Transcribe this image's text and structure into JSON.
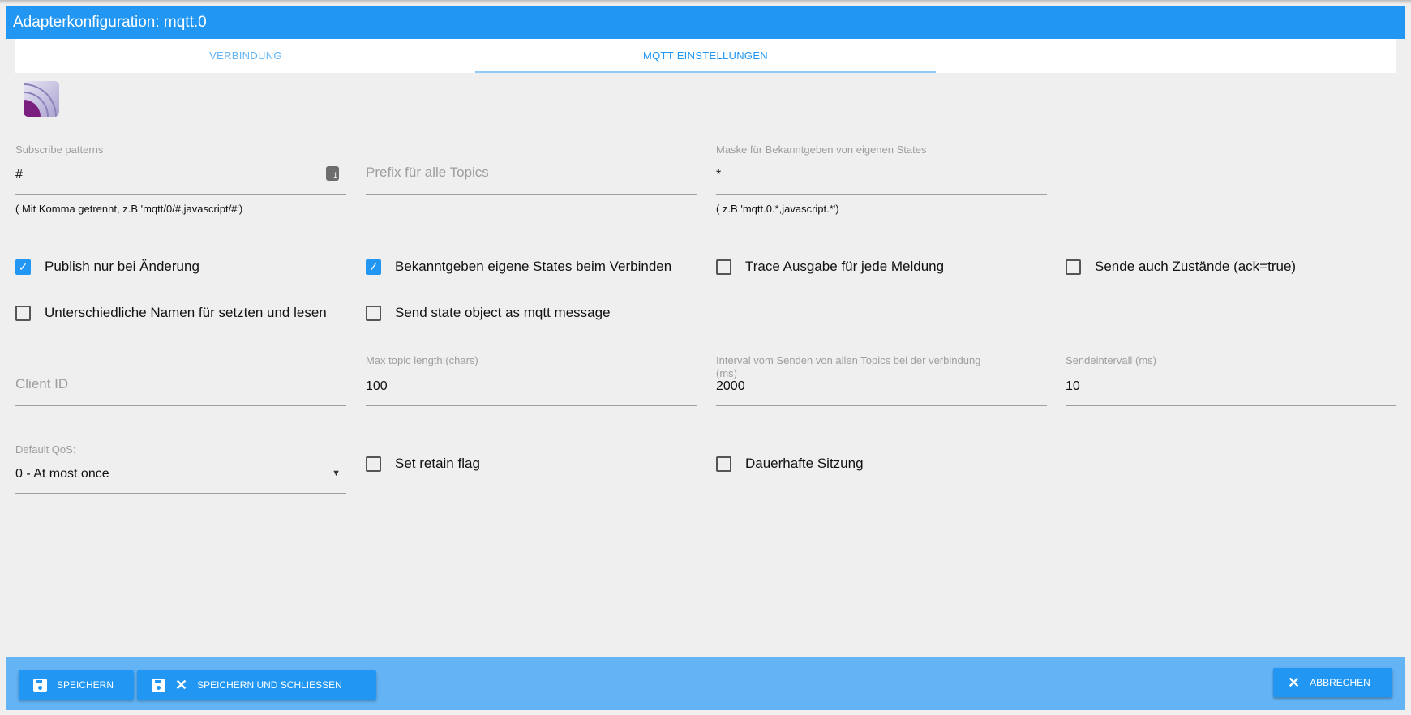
{
  "window": {
    "title": "Adapterkonfiguration: mqtt.0"
  },
  "tabs": [
    {
      "label": "VERBINDUNG",
      "active": false
    },
    {
      "label": "MQTT EINSTELLUNGEN",
      "active": true
    }
  ],
  "colors": {
    "primary": "#2196f3",
    "bottom_bar": "#63b3f5",
    "background": "#efefef"
  },
  "fields": {
    "subscribe": {
      "label": "Subscribe patterns",
      "value": "#",
      "helper": "( Mit Komma getrennt, z.B 'mqtt/0/#,javascript/#')",
      "icon": "counter-icon"
    },
    "prefix": {
      "placeholder": "Prefix für alle Topics"
    },
    "mask": {
      "label": "Maske für Bekanntgeben von eigenen States",
      "value": "*",
      "helper": "( z.B 'mqtt.0.*,javascript.*')"
    },
    "client_id": {
      "placeholder": "Client ID"
    },
    "max_topic": {
      "label": "Max topic length:(chars)",
      "value": "100"
    },
    "interval_all": {
      "label": "Interval vom Senden von allen Topics bei der verbindung (ms)",
      "value": "2000"
    },
    "send_interval": {
      "label": "Sendeintervall (ms)",
      "value": "10"
    },
    "qos": {
      "label": "Default QoS:",
      "value": "0 - At most once"
    }
  },
  "checkboxes": [
    {
      "label": "Publish nur bei Änderung",
      "checked": true
    },
    {
      "label": "Bekanntgeben eigene States beim Verbinden",
      "checked": true
    },
    {
      "label": "Trace Ausgabe für jede Meldung",
      "checked": false
    },
    {
      "label": "Sende auch Zustände (ack=true)",
      "checked": false
    },
    {
      "label": "Unterschiedliche Namen für setzten und lesen",
      "checked": false
    },
    {
      "label": "Send state object as mqtt message",
      "checked": false
    },
    {
      "label": "Set retain flag",
      "checked": false
    },
    {
      "label": "Dauerhafte Sitzung",
      "checked": false
    }
  ],
  "buttons": {
    "save": "SPEICHERN",
    "save_close": "SPEICHERN UND SCHLIESSEN",
    "cancel": "ABBRECHEN"
  }
}
